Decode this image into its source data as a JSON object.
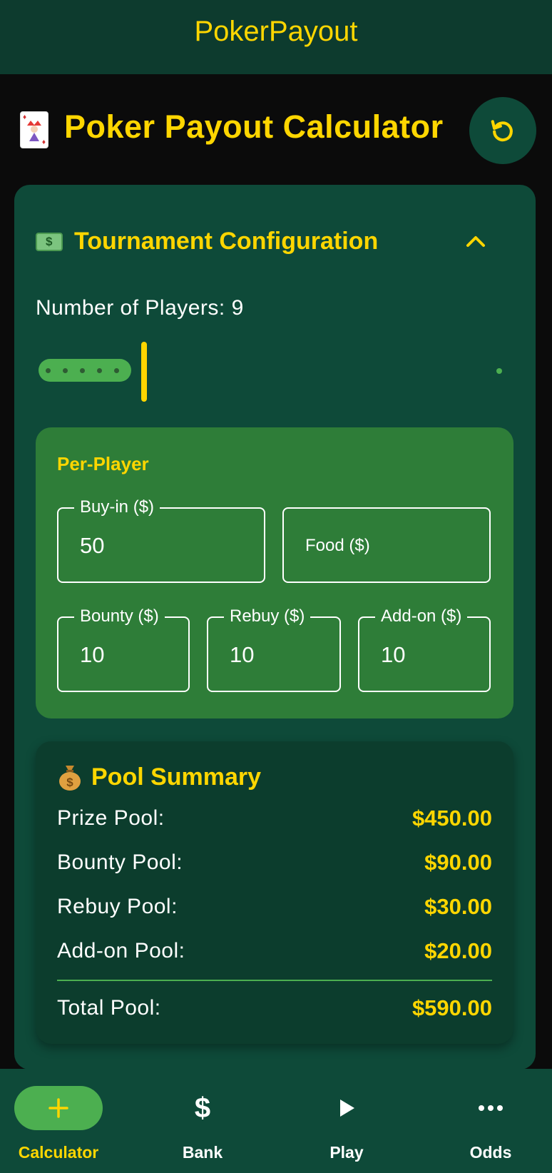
{
  "app_bar": {
    "title": "PokerPayout"
  },
  "header": {
    "title": "Poker Payout Calculator",
    "reset_icon": "refresh-icon"
  },
  "config": {
    "section_title": "Tournament Configuration",
    "players_label": "Number of Players: 9",
    "players_value": 9,
    "per_player": {
      "title": "Per-Player",
      "buy_in": {
        "label": "Buy-in ($)",
        "value": "50"
      },
      "food": {
        "label": "Food ($)",
        "value": ""
      },
      "bounty": {
        "label": "Bounty ($)",
        "value": "10"
      },
      "rebuy": {
        "label": "Rebuy ($)",
        "value": "10"
      },
      "addon": {
        "label": "Add-on ($)",
        "value": "10"
      }
    }
  },
  "summary": {
    "title": "Pool Summary",
    "rows": [
      {
        "label": "Prize Pool:",
        "value": "$450.00"
      },
      {
        "label": "Bounty Pool:",
        "value": "$90.00"
      },
      {
        "label": "Rebuy Pool:",
        "value": "$30.00"
      },
      {
        "label": "Add-on Pool:",
        "value": "$20.00"
      }
    ],
    "total": {
      "label": "Total Pool:",
      "value": "$590.00"
    }
  },
  "nav": [
    {
      "label": "Calculator",
      "icon": "plus-icon",
      "active": true
    },
    {
      "label": "Bank",
      "icon": "dollar-icon",
      "active": false
    },
    {
      "label": "Play",
      "icon": "play-icon",
      "active": false
    },
    {
      "label": "Odds",
      "icon": "more-icon",
      "active": false
    }
  ],
  "colors": {
    "accent": "#ffd600",
    "primary_dark": "#0d3b2e",
    "card": "#0e4a39",
    "green": "#2e7d38",
    "active_green": "#4caf50"
  }
}
